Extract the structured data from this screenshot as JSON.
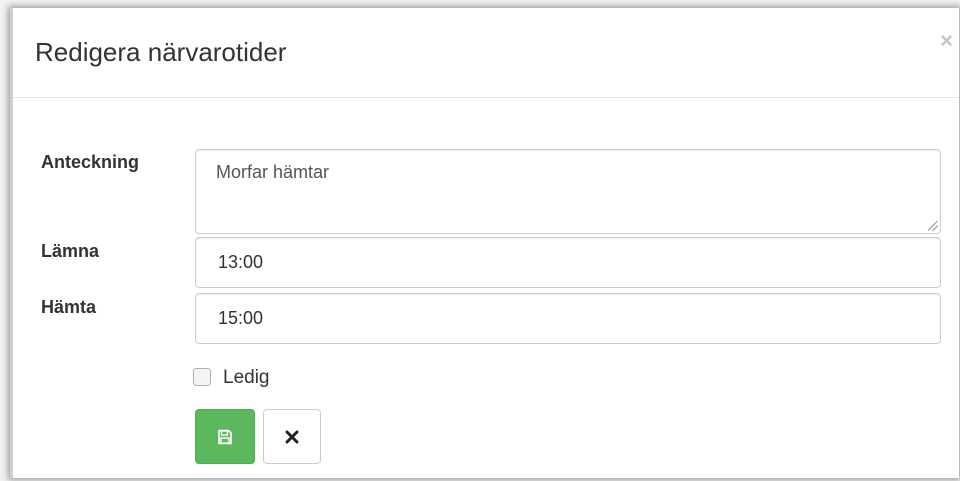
{
  "dialog": {
    "title": "Redigera närvarotider",
    "close_symbol": "×"
  },
  "form": {
    "note": {
      "label": "Anteckning",
      "value": "Morfar hämtar"
    },
    "drop_off": {
      "label": "Lämna",
      "value": "13:00"
    },
    "pick_up": {
      "label": "Hämta",
      "value": "15:00"
    },
    "off_checkbox": {
      "label": "Ledig",
      "checked": false
    }
  },
  "buttons": {
    "save_icon": "floppy-disk-icon",
    "cancel_icon": "close-icon"
  },
  "colors": {
    "save_green": "#5cb85c",
    "close_grey": "#c4c4c4"
  }
}
